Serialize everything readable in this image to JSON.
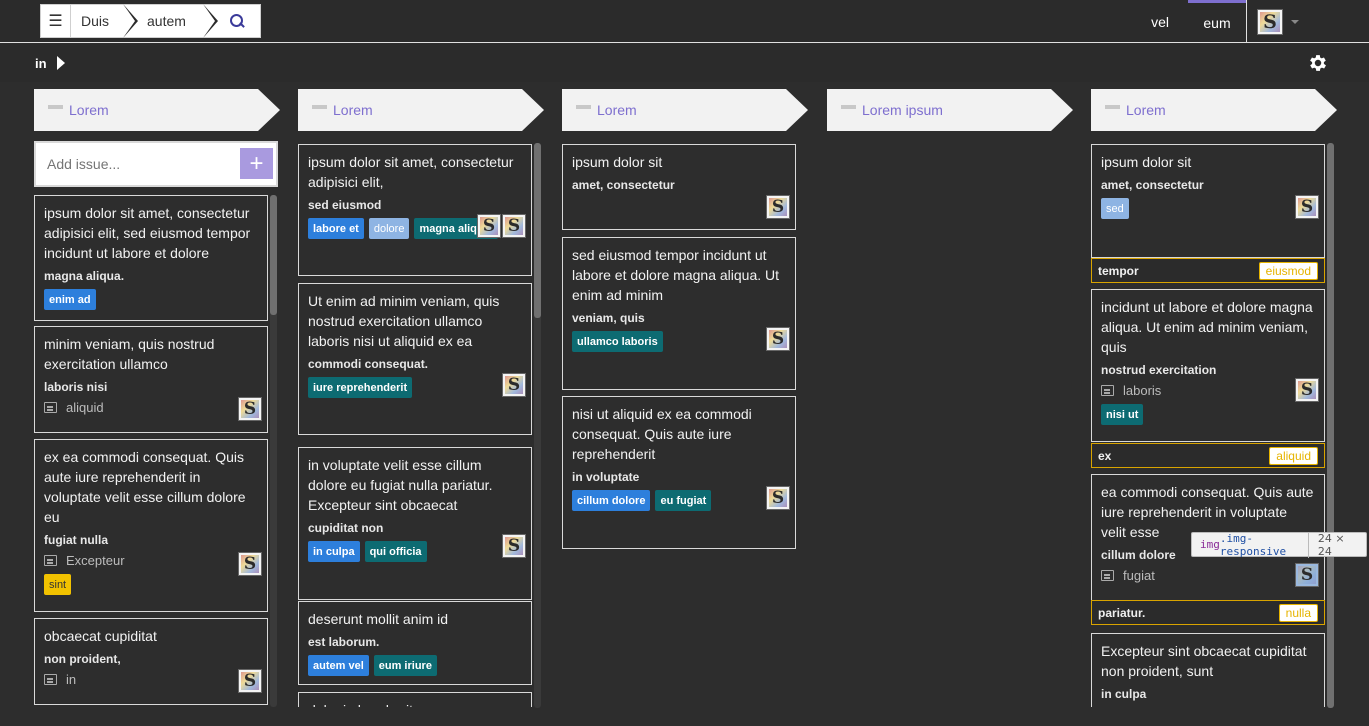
{
  "nav": {
    "crumbs": [
      "Duis",
      "autem"
    ],
    "links": [
      "vel",
      "eum"
    ],
    "active_link": "eum",
    "user_avatar": "S"
  },
  "subbar": {
    "label": "in"
  },
  "colors": {
    "accent": "#7e6fcf",
    "tag_blue": "#2d7fdc",
    "tag_teal": "#0d6b72",
    "tag_yellow": "#f2c200",
    "footer_gold": "#d9a400"
  },
  "add_issue": {
    "placeholder": "Add issue...",
    "button": "+"
  },
  "columns": [
    {
      "title": "Lorem",
      "cards": [
        {
          "title": "ipsum dolor sit amet, consectetur adipisici elit, sed eiusmod tempor incidunt ut labore et dolore",
          "sub": "magna aliqua.",
          "tags": [
            {
              "text": "enim ad",
              "color": "blue"
            }
          ]
        },
        {
          "title": "minim veniam, quis nostrud exercitation ullamco",
          "sub": "laboris nisi",
          "comment": "aliquid",
          "avatar": "S"
        },
        {
          "title": "ex ea commodi consequat. Quis aute iure reprehenderit in voluptate velit esse cillum dolore eu",
          "sub": "fugiat nulla",
          "comment": "Excepteur",
          "avatar": "S",
          "tags": [
            {
              "text": "sint",
              "color": "yellow"
            }
          ]
        },
        {
          "title": "obcaecat cupiditat",
          "sub": "non proident,",
          "comment": "in",
          "avatar": "S"
        }
      ]
    },
    {
      "title": "Lorem",
      "cards": [
        {
          "title": "ipsum dolor sit amet, consectetur adipisici elit,",
          "sub": "sed eiusmod",
          "avatars": [
            "S",
            "S"
          ],
          "tags": [
            {
              "text": "labore et",
              "color": "blue"
            },
            {
              "text": "dolore",
              "color": "lblue"
            },
            {
              "text": "magna aliqua.",
              "color": "teal"
            }
          ]
        },
        {
          "title": "Ut enim ad minim veniam, quis nostrud exercitation ullamco laboris nisi ut aliquid ex ea",
          "sub": "commodi consequat.",
          "avatar": "S",
          "tags": [
            {
              "text": "iure reprehenderit",
              "color": "teal"
            }
          ]
        },
        {
          "title": "in voluptate velit esse cillum dolore eu fugiat nulla pariatur. Excepteur sint obcaecat",
          "sub": "cupiditat non",
          "avatar": "S",
          "tags": [
            {
              "text": "in culpa",
              "color": "blue"
            },
            {
              "text": "qui officia",
              "color": "teal"
            }
          ]
        },
        {
          "title": "deserunt mollit anim id",
          "sub": "est laborum.",
          "tags": [
            {
              "text": "autem vel",
              "color": "blue"
            },
            {
              "text": "eum iriure",
              "color": "teal"
            }
          ]
        },
        {
          "title": "dolor in hendrerit"
        }
      ]
    },
    {
      "title": "Lorem",
      "cards": [
        {
          "title": "ipsum dolor sit",
          "sub": "amet, consectetur",
          "avatar": "S"
        },
        {
          "title": "sed eiusmod tempor incidunt ut labore et dolore magna aliqua. Ut enim ad minim",
          "sub": "veniam, quis",
          "avatar": "S",
          "tags": [
            {
              "text": "ullamco laboris",
              "color": "teal"
            }
          ]
        },
        {
          "title": "nisi ut aliquid ex ea commodi consequat. Quis aute iure reprehenderit",
          "sub": "in voluptate",
          "avatar": "S",
          "tags": [
            {
              "text": "cillum dolore",
              "color": "blue"
            },
            {
              "text": "eu fugiat",
              "color": "teal"
            }
          ]
        }
      ]
    },
    {
      "title": "Lorem ipsum",
      "cards": []
    },
    {
      "title": "Lorem",
      "cards": [
        {
          "title": "ipsum dolor sit",
          "sub": "amet, consectetur",
          "avatar": "S",
          "tags": [
            {
              "text": "sed",
              "color": "lblue"
            }
          ],
          "footer": {
            "label": "tempor",
            "badge": "eiusmod"
          }
        },
        {
          "title": "incidunt ut labore et dolore magna aliqua. Ut enim ad minim veniam, quis",
          "sub": "nostrud exercitation",
          "comment": "laboris",
          "avatar": "S",
          "tags": [
            {
              "text": "nisi ut",
              "color": "teal"
            }
          ],
          "footer": {
            "label": "ex",
            "badge": "aliquid"
          }
        },
        {
          "title": "ea commodi consequat. Quis aute iure reprehenderit in voluptate velit esse",
          "sub": "cillum dolore",
          "comment": "fugiat",
          "avatar": "S",
          "footer": {
            "label": "pariatur.",
            "badge": "nulla"
          }
        },
        {
          "title": "Excepteur sint obcaecat cupiditat non proident, sunt",
          "sub": "in culpa"
        }
      ]
    }
  ],
  "devtools_tooltip": {
    "tag": "img",
    "cls": ".img-responsive",
    "size": "24 × 24"
  }
}
